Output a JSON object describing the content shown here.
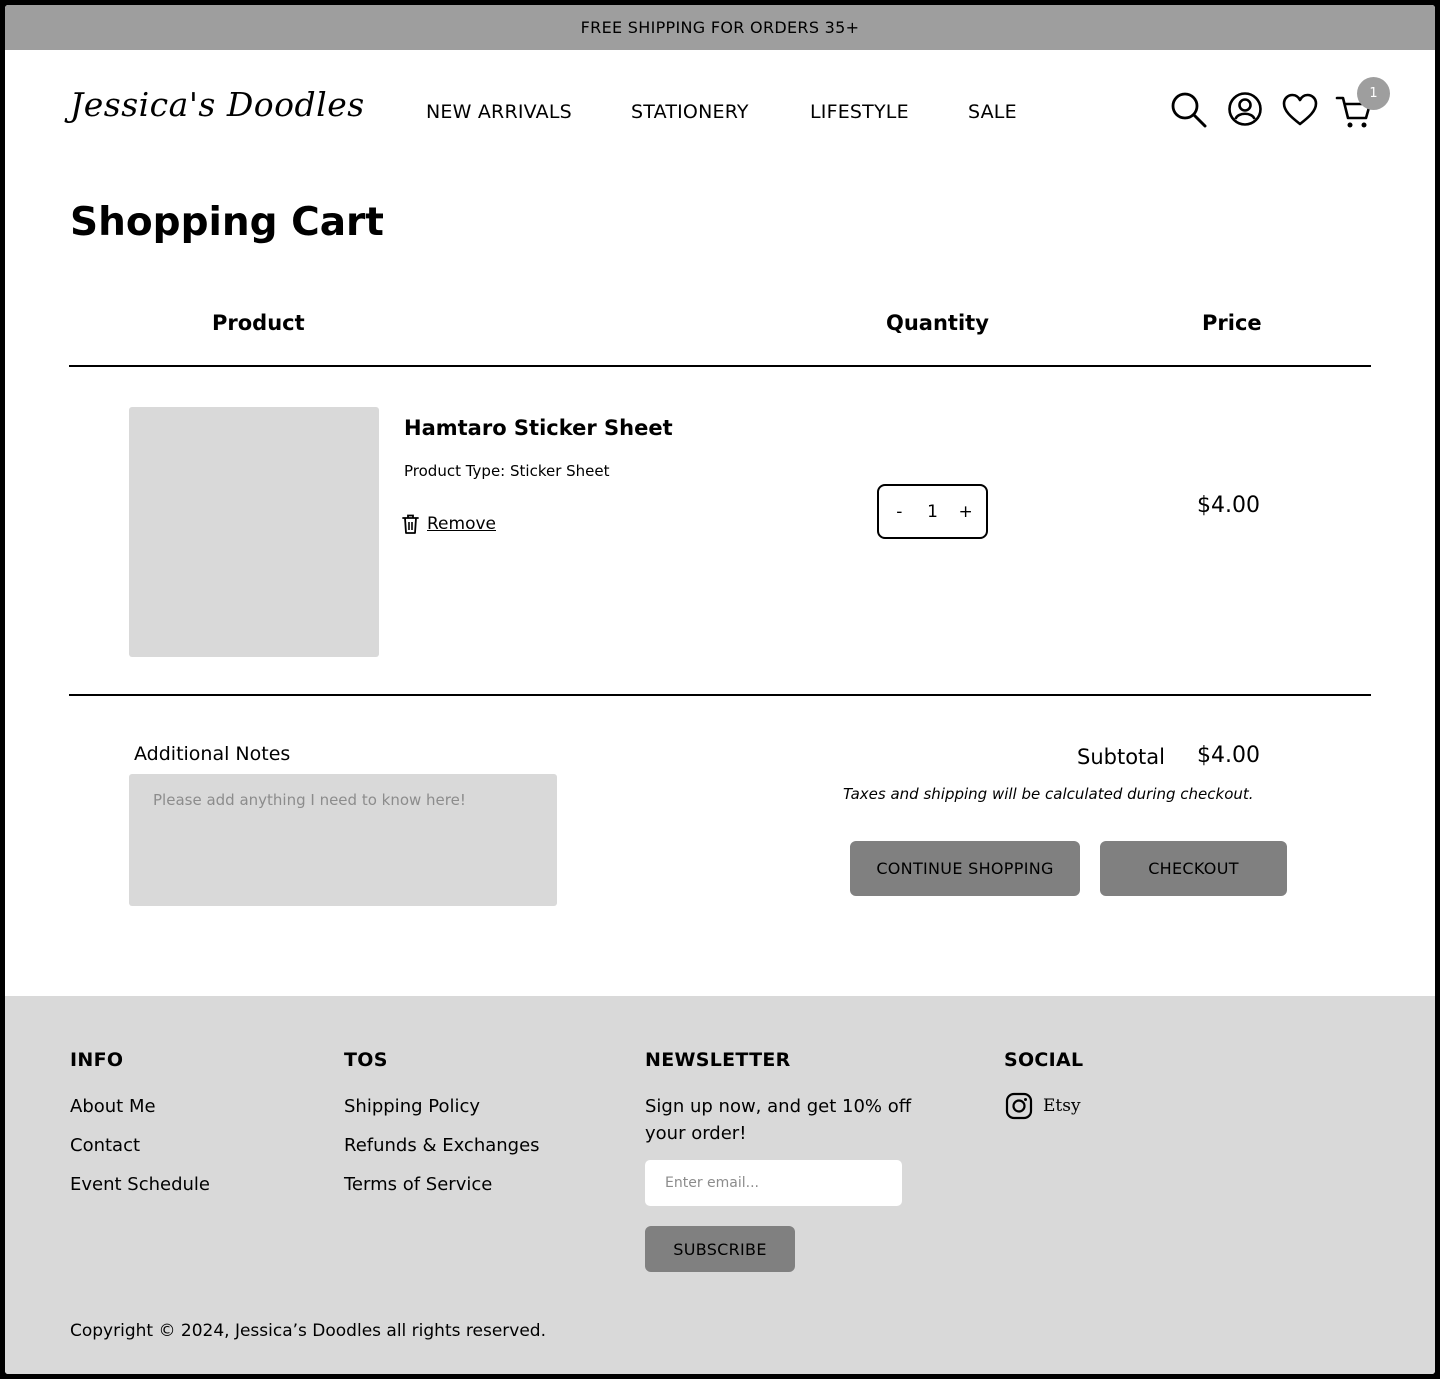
{
  "promo": {
    "text": "FREE SHIPPING FOR ORDERS 35+"
  },
  "header": {
    "logo": "Jessica's Doodles",
    "nav": [
      "NEW ARRIVALS",
      "STATIONERY",
      "LIFESTYLE",
      "SALE"
    ],
    "icons": [
      "search-icon",
      "account-icon",
      "heart-icon",
      "cart-icon"
    ],
    "cart_count": "1"
  },
  "cart": {
    "title": "Shopping Cart",
    "columns": {
      "product": "Product",
      "quantity": "Quantity",
      "price": "Price"
    },
    "items": [
      {
        "name": "Hamtaro Sticker Sheet",
        "type": "Product Type: Sticker Sheet",
        "remove_label": "Remove",
        "quantity": "1",
        "price": "$4.00"
      }
    ],
    "stepper": {
      "minus": "-",
      "plus": "+"
    },
    "notes_label": "Additional Notes",
    "notes_placeholder": "Please add anything I need to know here!",
    "subtotal_label": "Subtotal",
    "subtotal_value": "$4.00",
    "tax_note": "Taxes and shipping will be calculated during checkout.",
    "continue_label": "CONTINUE SHOPPING",
    "checkout_label": "CHECKOUT"
  },
  "footer": {
    "info": {
      "heading": "INFO",
      "links": [
        "About Me",
        "Contact",
        "Event Schedule"
      ]
    },
    "tos": {
      "heading": "TOS",
      "links": [
        "Shipping Policy",
        "Refunds & Exchanges",
        "Terms of Service"
      ]
    },
    "newsletter": {
      "heading": "NEWSLETTER",
      "text": "Sign up now, and get 10% off your order!",
      "placeholder": "Enter email...",
      "button": "SUBSCRIBE"
    },
    "social": {
      "heading": "SOCIAL",
      "etsy_label": "Etsy"
    },
    "copyright": "Copyright © 2024, Jessica’s Doodles all rights reserved."
  },
  "colors": {
    "promo_bg": "#9e9e9e",
    "button_bg": "#808080",
    "placeholder_gray": "#d9d9d9",
    "footer_bg": "#d9d9d9"
  }
}
